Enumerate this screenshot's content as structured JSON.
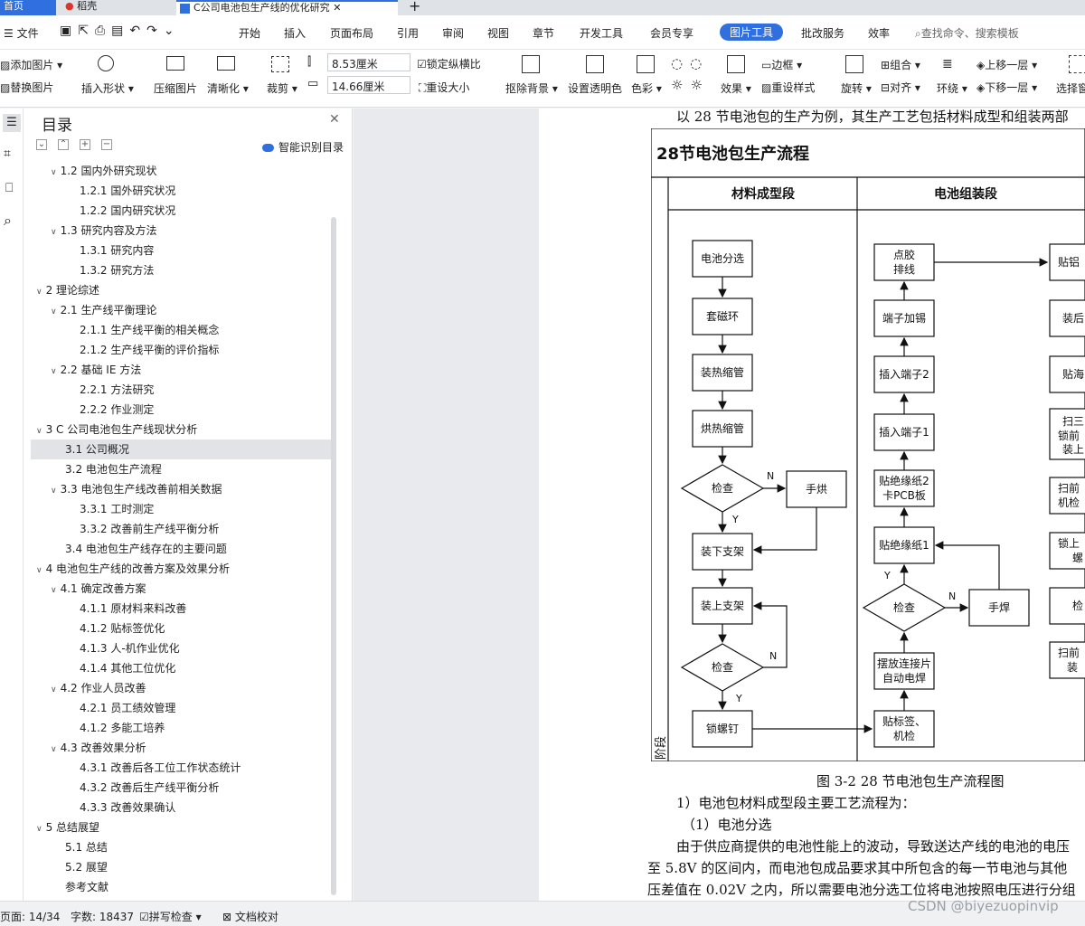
{
  "tabs": {
    "home": "首页",
    "daoke": "稻壳",
    "doc": "C公司电池包生产线的优化研究"
  },
  "menu": {
    "file": "文件",
    "items": [
      "开始",
      "插入",
      "页面布局",
      "引用",
      "审阅",
      "视图",
      "章节",
      "开发工具",
      "会员专享",
      "图片工具",
      "批改服务",
      "效率"
    ],
    "search": "查找命令、搜索模板"
  },
  "ribbon": {
    "add_image": "添加图片",
    "replace_image": "替换图片",
    "insert_shape": "插入形状",
    "compress": "压缩图片",
    "clarify": "清晰化",
    "crop": "裁剪",
    "width": "8.53厘米",
    "height": "14.66厘米",
    "lock_ratio": "锁定纵横比",
    "reset_size": "重设大小",
    "remove_bg": "抠除背景",
    "set_transparent": "设置透明色",
    "color": "色彩",
    "effect": "效果",
    "border": "边框",
    "reset_style": "重设样式",
    "group": "组合",
    "rotate": "旋转",
    "align": "对齐",
    "wrap": "环绕",
    "bring_forward": "上移一层",
    "send_backward": "下移一层",
    "select_pane": "选择窗格"
  },
  "toc": {
    "title": "目录",
    "smart": "智能识别目录",
    "items": [
      {
        "label": "1.2 国内外研究现状",
        "level": 2,
        "open": true
      },
      {
        "label": "1.2.1 国外研究状况",
        "level": 3
      },
      {
        "label": "1.2.2 国内研究状况",
        "level": 3
      },
      {
        "label": "1.3 研究内容及方法",
        "level": 2,
        "open": true
      },
      {
        "label": "1.3.1 研究内容",
        "level": 3
      },
      {
        "label": "1.3.2 研究方法",
        "level": 3
      },
      {
        "label": "2 理论综述",
        "level": 1,
        "open": true
      },
      {
        "label": "2.1 生产线平衡理论",
        "level": 2,
        "open": true
      },
      {
        "label": "2.1.1 生产线平衡的相关概念",
        "level": 3
      },
      {
        "label": "2.1.2 生产线平衡的评价指标",
        "level": 3
      },
      {
        "label": "2.2 基础 IE 方法",
        "level": 2,
        "open": true
      },
      {
        "label": "2.2.1 方法研究",
        "level": 3
      },
      {
        "label": "2.2.2 作业测定",
        "level": 3
      },
      {
        "label": "3 C 公司电池包生产线现状分析",
        "level": 1,
        "open": true
      },
      {
        "label": "3.1 公司概况",
        "level": 2,
        "selected": true
      },
      {
        "label": "3.2 电池包生产流程",
        "level": 2
      },
      {
        "label": "3.3 电池包生产线改善前相关数据",
        "level": 2,
        "open": true
      },
      {
        "label": "3.3.1 工时测定",
        "level": 3
      },
      {
        "label": "3.3.2 改善前生产线平衡分析",
        "level": 3
      },
      {
        "label": "3.4 电池包生产线存在的主要问题",
        "level": 2
      },
      {
        "label": "4 电池包生产线的改善方案及效果分析",
        "level": 1,
        "open": true
      },
      {
        "label": "4.1 确定改善方案",
        "level": 2,
        "open": true
      },
      {
        "label": "4.1.1 原材料来料改善",
        "level": 3
      },
      {
        "label": "4.1.2 贴标签优化",
        "level": 3
      },
      {
        "label": "4.1.3 人-机作业优化",
        "level": 3
      },
      {
        "label": "4.1.4 其他工位优化",
        "level": 3
      },
      {
        "label": "4.2 作业人员改善",
        "level": 2,
        "open": true
      },
      {
        "label": "4.2.1 员工绩效管理",
        "level": 3
      },
      {
        "label": "4.1.2 多能工培养",
        "level": 3
      },
      {
        "label": "4.3 改善效果分析",
        "level": 2,
        "open": true
      },
      {
        "label": "4.3.1 改善后各工位工作状态统计",
        "level": 3
      },
      {
        "label": "4.3.2 改善后生产线平衡分析",
        "level": 3
      },
      {
        "label": "4.3.3 改善效果确认",
        "level": 3
      },
      {
        "label": "5 总结展望",
        "level": 1,
        "open": true
      },
      {
        "label": "5.1 总结",
        "level": 2
      },
      {
        "label": "5.2 展望",
        "level": 2
      },
      {
        "label": "参考文献",
        "level": 2
      }
    ]
  },
  "doc": {
    "intro": "以 28 节电池包的生产为例，其生产工艺包括材料成型和组装两部",
    "caption": "图 3-2 28 节电池包生产流程图",
    "p1": "1）电池包材料成型段主要工艺流程为：",
    "p2": "（1）电池分选",
    "p3": "由于供应商提供的电池性能上的波动，导致送达产线的电池的电压",
    "p4": "至 5.8V 的区间内，而电池包成品要求其中所包含的每一节电池与其他",
    "p5": "压差值在 0.02V 之内，所以需要电池分选工位将电池按照电压进行分组"
  },
  "flow": {
    "title": "28节电池包生产流程",
    "col1": "材料成型段",
    "col2": "电池组装段",
    "stage": "阶段",
    "left": [
      "电池分选",
      "套磁环",
      "装热缩管",
      "烘热缩管",
      "检查",
      "手烘",
      "装下支架",
      "装上支架",
      "检查",
      "锁螺钉"
    ],
    "mid": [
      "点胶",
      "排线",
      "端子加锡",
      "插入端子2",
      "插入端子1",
      "贴绝缘纸2",
      "卡PCB板",
      "贴绝缘纸1",
      "检查",
      "手焊",
      "摆放连接片",
      "自动电焊",
      "贴标签、",
      "机检"
    ],
    "right": [
      "贴铝",
      "装后",
      "贴海",
      "扫三",
      "锁前",
      "装上",
      "扫前",
      "机检",
      "锁上",
      "螺",
      "检",
      "扫前",
      "装"
    ],
    "yes": "Y",
    "no": "N"
  },
  "status": {
    "page": "页面: 14/34",
    "words": "字数: 18437",
    "spell": "拼写检查",
    "proof": "文档校对"
  },
  "watermark": "CSDN @biyezuopinvip"
}
